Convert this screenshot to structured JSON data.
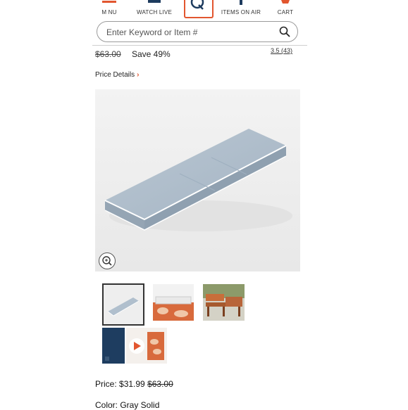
{
  "nav": {
    "menu": "M NU",
    "watch_live": "WATCH LIVE",
    "items_on_air": "ITEMS ON AIR",
    "cart": "CART",
    "logo_letter": "Q"
  },
  "search": {
    "placeholder": "Enter Keyword or Item #"
  },
  "product": {
    "old_price": "$63.00",
    "save_text": "Save 49%",
    "rating": "3.5",
    "review_count": "(43)",
    "price_details_label": "Price Details",
    "price_label": "Price: ",
    "price": "$31.99",
    "price_old": "$63.00",
    "color_line": "Color: Gray Solid"
  },
  "colors": {
    "accent": "#e2562f",
    "cushion": "#a9b9c8",
    "navy": "#1d3b5e",
    "terracotta": "#d86a3c"
  },
  "icons": [
    "menu-icon",
    "tv-icon",
    "q-logo",
    "items-on-air-icon",
    "cart-icon",
    "search-icon",
    "zoom-icon",
    "play-icon"
  ]
}
